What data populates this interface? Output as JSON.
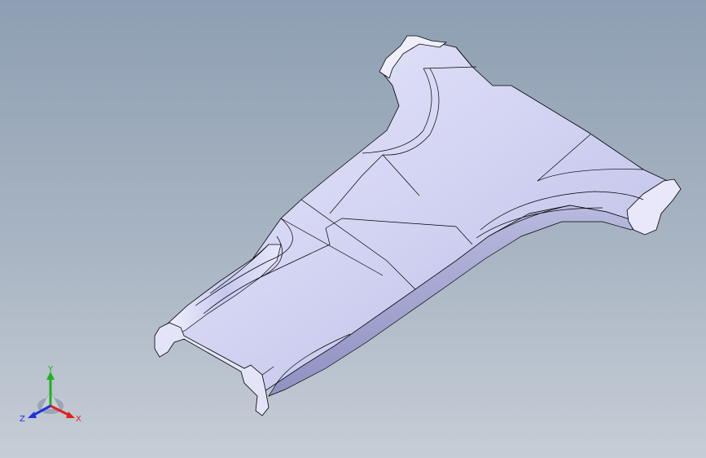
{
  "view": {
    "name": "isometric-3d-view",
    "background_top": "#8e9fb3",
    "background_bottom": "#c6cdd6"
  },
  "model": {
    "description_icon": "automotive-pillar-trim-part",
    "face_color": "#d9daf4",
    "edge_color": "#000000"
  },
  "triad": {
    "x_label": "X",
    "y_label": "Y",
    "z_label": "Z",
    "x_color": "#e02020",
    "y_color": "#20b020",
    "z_color": "#2030e0"
  }
}
